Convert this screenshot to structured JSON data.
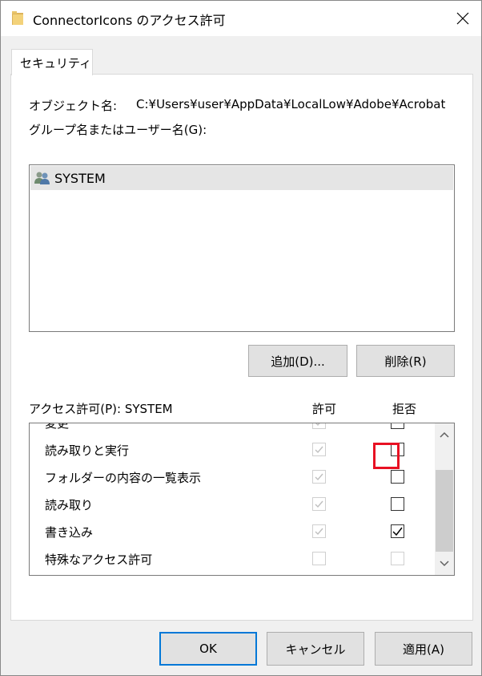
{
  "window": {
    "title": "ConnectorIcons のアクセス許可",
    "folder_icon": "folder-icon",
    "close_icon": "close-icon"
  },
  "tabs": [
    {
      "label": "セキュリティ",
      "active": true
    }
  ],
  "object": {
    "label": "オブジェクト名:",
    "path": "C:¥Users¥user¥AppData¥LocalLow¥Adobe¥Acrobat"
  },
  "groups": {
    "label": "グループ名またはユーザー名(G):",
    "items": [
      {
        "name": "SYSTEM",
        "icon": "users-icon",
        "selected": true
      }
    ],
    "add_button": "追加(D)...",
    "remove_button": "削除(R)"
  },
  "permissions": {
    "label": "アクセス許可(P): SYSTEM",
    "allow_header": "許可",
    "deny_header": "拒否",
    "rows": [
      {
        "name": "変更",
        "allow": true,
        "deny": false
      },
      {
        "name": "読み取りと実行",
        "allow": true,
        "deny": false
      },
      {
        "name": "フォルダーの内容の一覧表示",
        "allow": true,
        "deny": false
      },
      {
        "name": "読み取り",
        "allow": true,
        "deny": false
      },
      {
        "name": "書き込み",
        "allow": true,
        "deny": true
      },
      {
        "name": "特殊なアクセス許可",
        "allow": false,
        "deny": false
      }
    ],
    "highlight_color": "#e81123"
  },
  "footer": {
    "ok": "OK",
    "cancel": "キャンセル",
    "apply": "適用(A)",
    "ok_border_color": "#0078d7"
  }
}
